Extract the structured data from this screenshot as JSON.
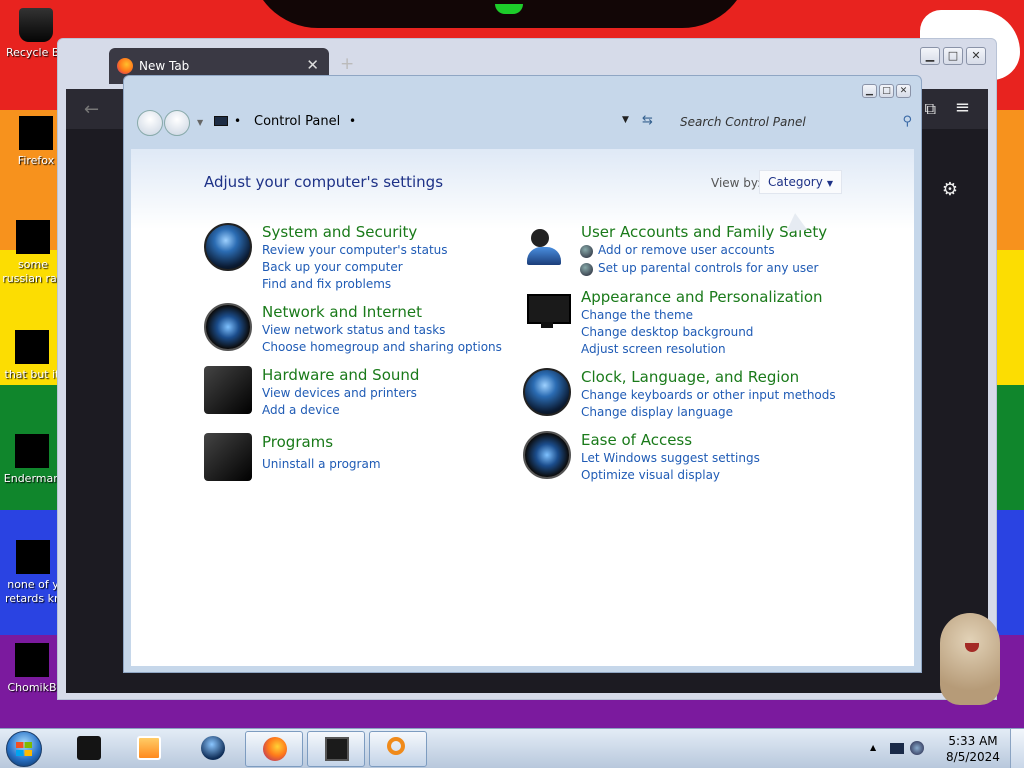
{
  "desktop": {
    "icons": [
      {
        "label": "Recycle Bin"
      },
      {
        "label": "Firefox"
      },
      {
        "label": "some russian ran a ra"
      },
      {
        "label": "that but it"
      },
      {
        "label": "Enderman"
      },
      {
        "label": "none of y retards kn"
      },
      {
        "label": "ChomikB"
      }
    ]
  },
  "browser": {
    "tab_title": "New Tab",
    "tab_close": "✕",
    "new_tab": "+",
    "back": "←",
    "menu": "≡"
  },
  "control_panel": {
    "breadcrumb": "Control Panel",
    "search_placeholder": "Search Control Panel",
    "heading": "Adjust your computer's settings",
    "view_by_label": "View by:",
    "view_by_value": "Category",
    "categories": [
      {
        "title": "System and Security",
        "icon": "security-globe-icon",
        "links": [
          "Review your computer's status",
          "Back up your computer",
          "Find and fix problems"
        ]
      },
      {
        "title": "Network and Internet",
        "icon": "network-globe-icon",
        "links": [
          "View network status and tasks",
          "Choose homegroup and sharing options"
        ]
      },
      {
        "title": "Hardware and Sound",
        "icon": "printer-speaker-icon",
        "links": [
          "View devices and printers",
          "Add a device"
        ]
      },
      {
        "title": "Programs",
        "icon": "programs-box-icon",
        "links": [
          "Uninstall a program"
        ]
      },
      {
        "title": "User Accounts and Family Safety",
        "icon": "users-icon",
        "links": [
          "Add or remove user accounts",
          "Set up parental controls for any user"
        ]
      },
      {
        "title": "Appearance and Personalization",
        "icon": "monitor-icon",
        "links": [
          "Change the theme",
          "Change desktop background",
          "Adjust screen resolution"
        ]
      },
      {
        "title": "Clock, Language, and Region",
        "icon": "clock-globe-icon",
        "links": [
          "Change keyboards or other input methods",
          "Change display language"
        ]
      },
      {
        "title": "Ease of Access",
        "icon": "ease-of-access-icon",
        "links": [
          "Let Windows suggest settings",
          "Optimize visual display"
        ]
      }
    ]
  },
  "taskbar": {
    "time": "5:33 AM",
    "date": "8/5/2024",
    "pinned": [
      "black-square-app",
      "media-player",
      "globe-app",
      "firefox",
      "monitor-app",
      "search-magnifier-app"
    ]
  },
  "colors": {
    "category_title": "#1a7a1a",
    "link": "#1f5bb5",
    "heading": "#1e3287"
  }
}
